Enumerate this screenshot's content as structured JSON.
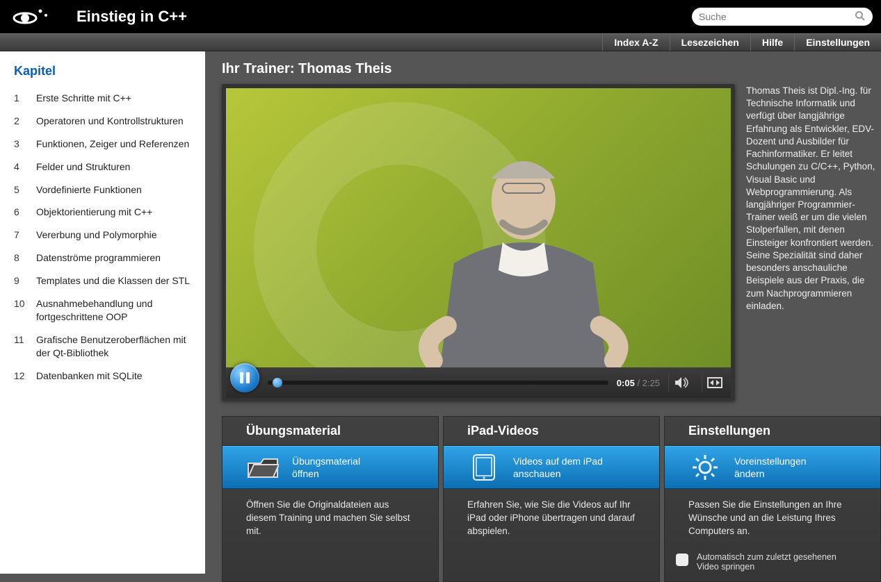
{
  "header": {
    "title": "Einstieg in C++",
    "search_placeholder": "Suche"
  },
  "nav": {
    "index": "Index A-Z",
    "bookmarks": "Lesezeichen",
    "help": "Hilfe",
    "settings": "Einstellungen"
  },
  "sidebar": {
    "title": "Kapitel",
    "chapters": [
      {
        "num": "1",
        "title": "Erste Schritte mit C++"
      },
      {
        "num": "2",
        "title": "Operatoren und Kontrollstrukturen"
      },
      {
        "num": "3",
        "title": "Funktionen, Zeiger und Referenzen"
      },
      {
        "num": "4",
        "title": "Felder und Strukturen"
      },
      {
        "num": "5",
        "title": "Vordefinierte Funktionen"
      },
      {
        "num": "6",
        "title": "Objektorientierung mit C++"
      },
      {
        "num": "7",
        "title": "Vererbung und Polymorphie"
      },
      {
        "num": "8",
        "title": "Datenströme programmieren"
      },
      {
        "num": "9",
        "title": "Templates und die Klassen der STL"
      },
      {
        "num": "10",
        "title": "Ausnahmebehandlung und fortgeschrittene OOP"
      },
      {
        "num": "11",
        "title": "Grafische Benutzeroberflächen mit der Qt-Bibliothek"
      },
      {
        "num": "12",
        "title": "Datenbanken mit SQLite"
      }
    ]
  },
  "page": {
    "title": "Ihr Trainer: Thomas Theis"
  },
  "video": {
    "elapsed": "0:05",
    "duration": "2:25"
  },
  "bio": "Thomas Theis ist Dipl.-Ing. für Technische Informatik und verfügt über langjährige Erfahrung als Entwickler, EDV-Dozent und Ausbilder für Fachinformatiker. Er leitet Schulungen zu C/C++, Python, Visual Basic und Webprogrammierung. Als langjähriger Programmier-Trainer weiß er um die vielen Stolperfallen, mit denen Einsteiger konfrontiert werden. Seine Spezialität sind daher besonders anschauliche Beispiele aus der Praxis, die zum Nachprogrammieren einladen.",
  "cards": {
    "c0": {
      "title": "Übungsmaterial",
      "action_l1": "Übungsmaterial",
      "action_l2": "öffnen",
      "desc": "Öffnen Sie die Originaldateien aus diesem Training und machen Sie selbst mit."
    },
    "c1": {
      "title": "iPad-Videos",
      "action_l1": "Videos auf dem iPad",
      "action_l2": "anschauen",
      "desc": "Erfahren Sie, wie Sie die Videos auf Ihr iPad oder iPhone übertragen und darauf abspielen."
    },
    "c2": {
      "title": "Einstellungen",
      "action_l1": "Voreinstellungen",
      "action_l2": "ändern",
      "desc": "Passen Sie die Einstellungen an Ihre Wünsche und an die Leistung Ihres Computers an.",
      "check": "Automatisch zum zuletzt gesehenen Video springen"
    }
  }
}
